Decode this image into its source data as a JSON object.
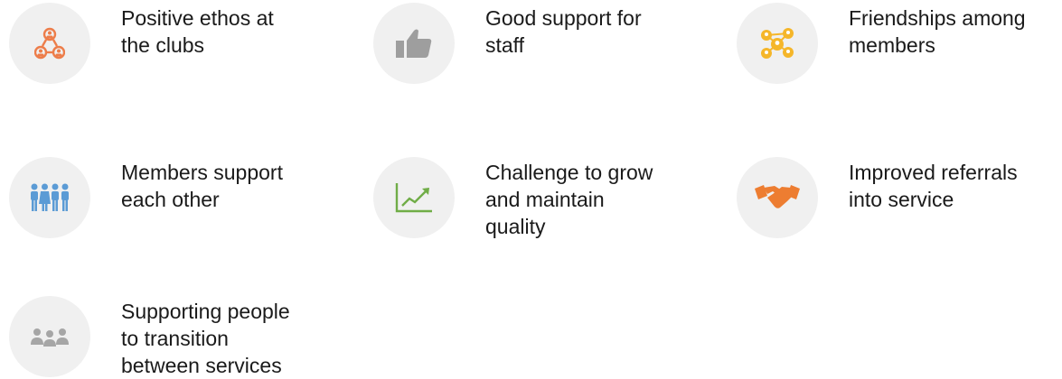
{
  "items": [
    {
      "label": "Positive ethos at\nthe clubs",
      "icon": "people-network-icon",
      "color": "#ed7d4a"
    },
    {
      "label": "Good support for\nstaff",
      "icon": "thumbs-up-icon",
      "color": "#9e9e9e"
    },
    {
      "label": "Friendships among\nmembers",
      "icon": "connected-people-icon",
      "color": "#f5b62a"
    },
    {
      "label": "Members support\neach other",
      "icon": "group-people-icon",
      "color": "#5b9bd5"
    },
    {
      "label": "Challenge to grow\nand maintain\nquality",
      "icon": "growth-chart-icon",
      "color": "#70ad47"
    },
    {
      "label": "Improved referrals\ninto service",
      "icon": "handshake-icon",
      "color": "#ed7d31"
    },
    {
      "label": "Supporting people\nto transition\nbetween services",
      "icon": "three-people-icon",
      "color": "#a6a6a6"
    }
  ]
}
